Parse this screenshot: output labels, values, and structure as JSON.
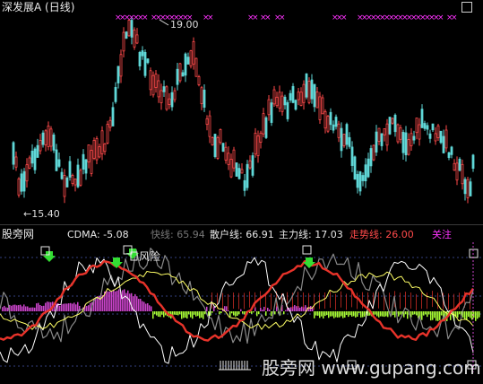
{
  "window": {
    "title": "深发展A (日线)"
  },
  "upper_chart": {
    "high_label": "19.00",
    "low_label": "←15.40"
  },
  "indicator": {
    "site_label": "股旁网",
    "cdma_label": "CDMA: -5.08",
    "fast_label": "快线: 65.94",
    "retail_label": "散户线: 66.91",
    "main_label": "主力线: 17.03",
    "trend_label": "走势线: 26.00",
    "follow_label": "关注",
    "risk_label": "风险"
  },
  "watermark": {
    "text": "股旁网 www.gupang.com"
  },
  "colors": {
    "up": "#ff4a4a",
    "down": "#5fd7d7",
    "marker": "#ff33ff",
    "red_line": "#e8332a",
    "white_line": "#ffffff",
    "yellow_line": "#ffff66",
    "gray_line": "#8a8a8a",
    "green_arrow": "#33dd33",
    "magenta_bar": "#cc44cc",
    "green_bar": "#aaff33"
  },
  "icons": {
    "top_right": "square-outline-icon",
    "bottom_markers": "square-outline-icon"
  }
}
